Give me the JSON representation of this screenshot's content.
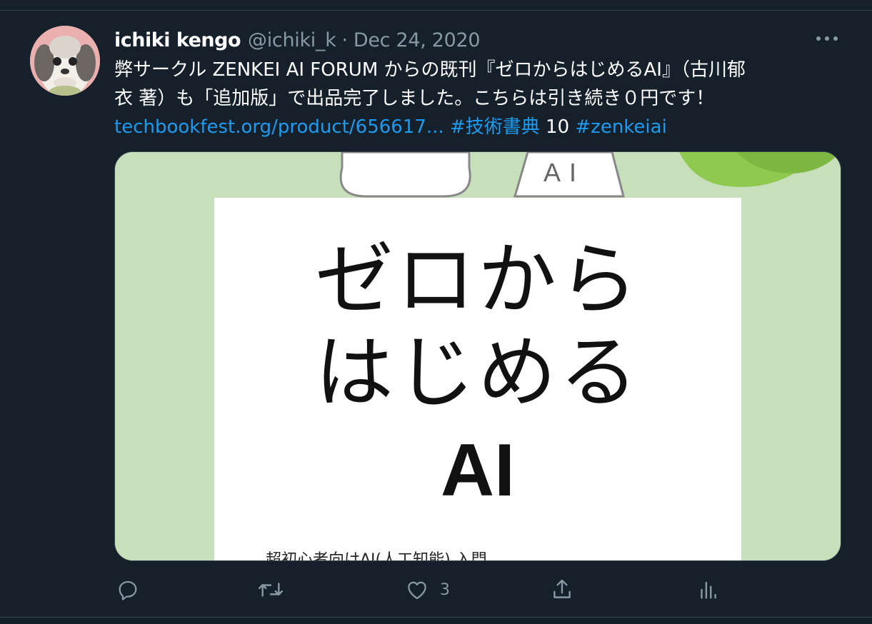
{
  "tweet": {
    "author_name": "ichiki kengo",
    "author_handle": "@ichiki_k",
    "separator": "·",
    "date": "Dec 24, 2020",
    "text_line1": "弊サークル ZENKEI AI FORUM からの既刊『ゼロからはじめるAI』（古川郁",
    "text_line2": "衣 著）も「追加版」で出品完了しました。こちらは引き続き０円です！",
    "link_url": "techbookfest.org/product/656617...",
    "hashtag1": "#技術書典",
    "hashtag1_suffix": " 10 ",
    "hashtag2": "#zenkeiai"
  },
  "card": {
    "flask_label": "AI",
    "title_line1": "ゼロから",
    "title_line2": "はじめる",
    "title_ai": "AI",
    "subtitle": "超初心者向けAI(人工知能) 入門"
  },
  "actions": {
    "reply_icon": "reply-icon",
    "retweet_icon": "retweet-icon",
    "like_icon": "heart-icon",
    "like_count": "3",
    "share_icon": "share-icon",
    "analytics_icon": "analytics-icon"
  },
  "colors": {
    "background": "#15202b",
    "link": "#1d9bf0",
    "secondary_text": "#8899a6",
    "card_bg": "#c7dfbb"
  }
}
